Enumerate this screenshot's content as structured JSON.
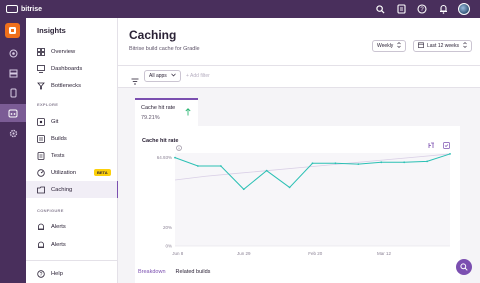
{
  "topbar": {
    "logo_text": "bitrise",
    "icons": [
      "search-icon",
      "doc-icon",
      "help-icon",
      "bell-icon",
      "avatar"
    ]
  },
  "rail": {
    "items": [
      "app-logo-icon",
      "radar-icon",
      "stack-icon",
      "device-icon",
      "insights-icon",
      "gear-icon"
    ]
  },
  "sidebar": {
    "title": "Insights",
    "items_top": [
      {
        "label": "Overview",
        "icon": "overview-icon"
      },
      {
        "label": "Dashboards",
        "icon": "dashboard-icon"
      },
      {
        "label": "Bottlenecks",
        "icon": "bottleneck-icon"
      }
    ],
    "explore_label": "EXPLORE",
    "items_explore": [
      {
        "label": "Git",
        "icon": "git-icon"
      },
      {
        "label": "Builds",
        "icon": "builds-icon"
      },
      {
        "label": "Tests",
        "icon": "tests-icon"
      },
      {
        "label": "Utilization",
        "icon": "utilization-icon",
        "badge": "BETA"
      },
      {
        "label": "Caching",
        "icon": "caching-icon",
        "active": true
      }
    ],
    "configure_label": "CONFIGURE",
    "items_configure": [
      {
        "label": "Alerts",
        "icon": "alerts-icon"
      },
      {
        "label": "Alerts",
        "icon": "alerts-icon"
      }
    ],
    "help_label": "Help"
  },
  "header": {
    "title": "Caching",
    "subtitle": "Bitrise build cache for Gradle",
    "granularity": "Weekly",
    "range": "Last 12 weeks"
  },
  "filters": {
    "apps": "All apps",
    "add_filter": "+ Add filter"
  },
  "metric": {
    "name": "Cache hit rate",
    "value": "79.21%"
  },
  "card": {
    "title": "Cache hit rate"
  },
  "chart_data": {
    "type": "line",
    "title": "Cache hit rate",
    "y_ticks": [
      "64.93%",
      "20%",
      "0%"
    ],
    "x_ticks": [
      "Jun 8",
      "Jun 29",
      "Feb 20",
      "Mar 12"
    ],
    "ylim": [
      0,
      100
    ],
    "series": [
      {
        "values": [
          95,
          86,
          86,
          61,
          81,
          63,
          89,
          89,
          88,
          90,
          90,
          91,
          99
        ]
      },
      {
        "values": [
          71,
          75,
          78,
          81,
          84,
          87,
          90,
          93,
          96,
          99
        ]
      }
    ],
    "grid": false,
    "colors": [
      "#2bc0b4",
      "#d9cfe6"
    ]
  },
  "bottom_tabs": [
    "Breakdown",
    "Related builds"
  ]
}
